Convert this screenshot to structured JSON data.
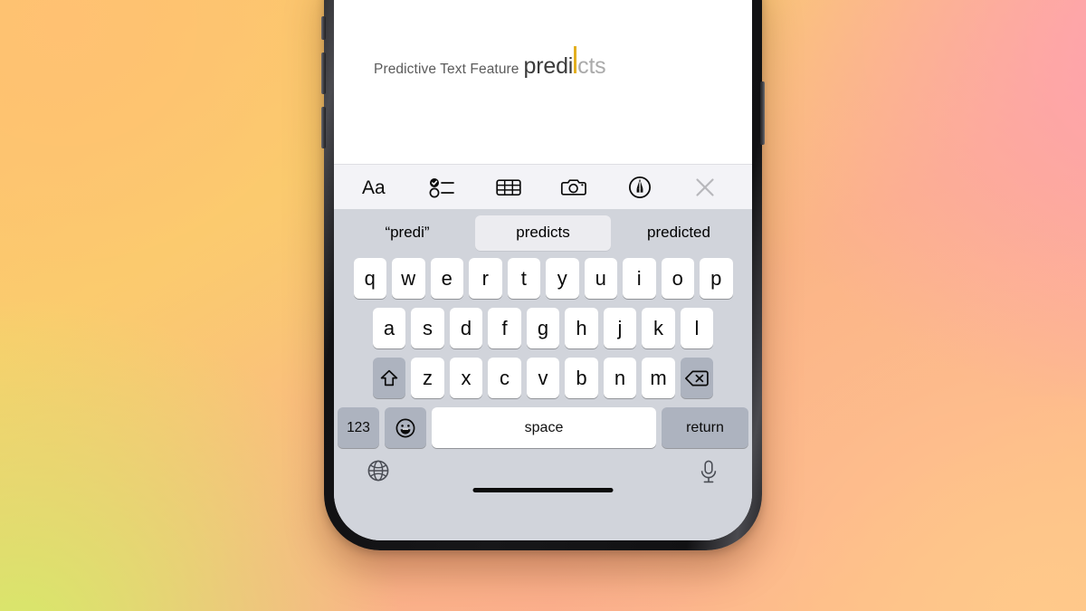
{
  "background": {
    "description": "warm gradient wallpaper",
    "colors": [
      "#FBC56B",
      "#F9D06C",
      "#FF9EB7",
      "#D7E86A",
      "#FCAE8E"
    ]
  },
  "device": {
    "name": "iphone",
    "frame_color": "#171719",
    "screen_bg": "#FFFFFF"
  },
  "note": {
    "prefix_text": "Predictive Text Feature",
    "typed_text": "predi",
    "ghost_text": "cts",
    "caret_color": "#E3AF1F"
  },
  "notes_toolbar": {
    "items": [
      {
        "name": "format-aa-icon",
        "label": "Aa"
      },
      {
        "name": "checklist-icon",
        "label": ""
      },
      {
        "name": "table-icon",
        "label": ""
      },
      {
        "name": "camera-icon",
        "label": ""
      },
      {
        "name": "markup-pen-icon",
        "label": ""
      },
      {
        "name": "close-icon",
        "label": ""
      }
    ]
  },
  "keyboard": {
    "predictive": [
      {
        "label": "“predi”",
        "selected": false
      },
      {
        "label": "predicts",
        "selected": true
      },
      {
        "label": "predicted",
        "selected": false
      }
    ],
    "row1": [
      "q",
      "w",
      "e",
      "r",
      "t",
      "y",
      "u",
      "i",
      "o",
      "p"
    ],
    "row2": [
      "a",
      "s",
      "d",
      "f",
      "g",
      "h",
      "j",
      "k",
      "l"
    ],
    "row3": [
      "z",
      "x",
      "c",
      "v",
      "b",
      "n",
      "m"
    ],
    "shift_label": "",
    "backspace_label": "",
    "numeric_label": "123",
    "emoji_label": "",
    "space_label": "space",
    "return_label": "return",
    "globe_label": "",
    "dictation_label": "",
    "key_bg": "#FFFFFF",
    "modifier_bg": "#ADB3BF",
    "keyboard_bg": "#D1D4DB"
  }
}
